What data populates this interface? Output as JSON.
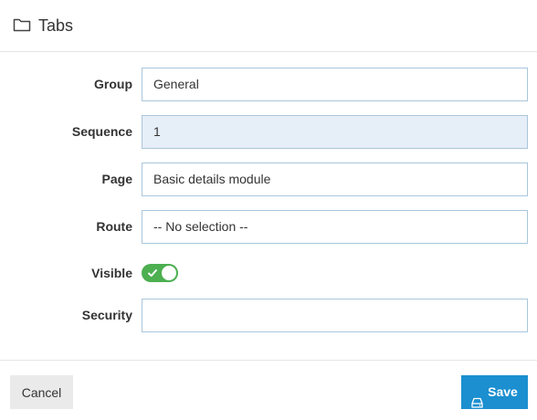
{
  "header": {
    "title": "Tabs",
    "icon": "folder-icon"
  },
  "form": {
    "group": {
      "label": "Group",
      "value": "General"
    },
    "sequence": {
      "label": "Sequence",
      "value": "1"
    },
    "page": {
      "label": "Page",
      "value": "Basic details module"
    },
    "route": {
      "label": "Route",
      "value": "-- No selection --"
    },
    "visible": {
      "label": "Visible",
      "checked": true
    },
    "security": {
      "label": "Security",
      "value": ""
    }
  },
  "footer": {
    "cancel_label": "Cancel",
    "save_label": "Save",
    "save_icon": "hdd-icon"
  },
  "colors": {
    "accent": "#1b8fd0",
    "toggle_on": "#4caf50",
    "field_border": "#a9c6dc",
    "field_shaded": "#e6eef7"
  }
}
